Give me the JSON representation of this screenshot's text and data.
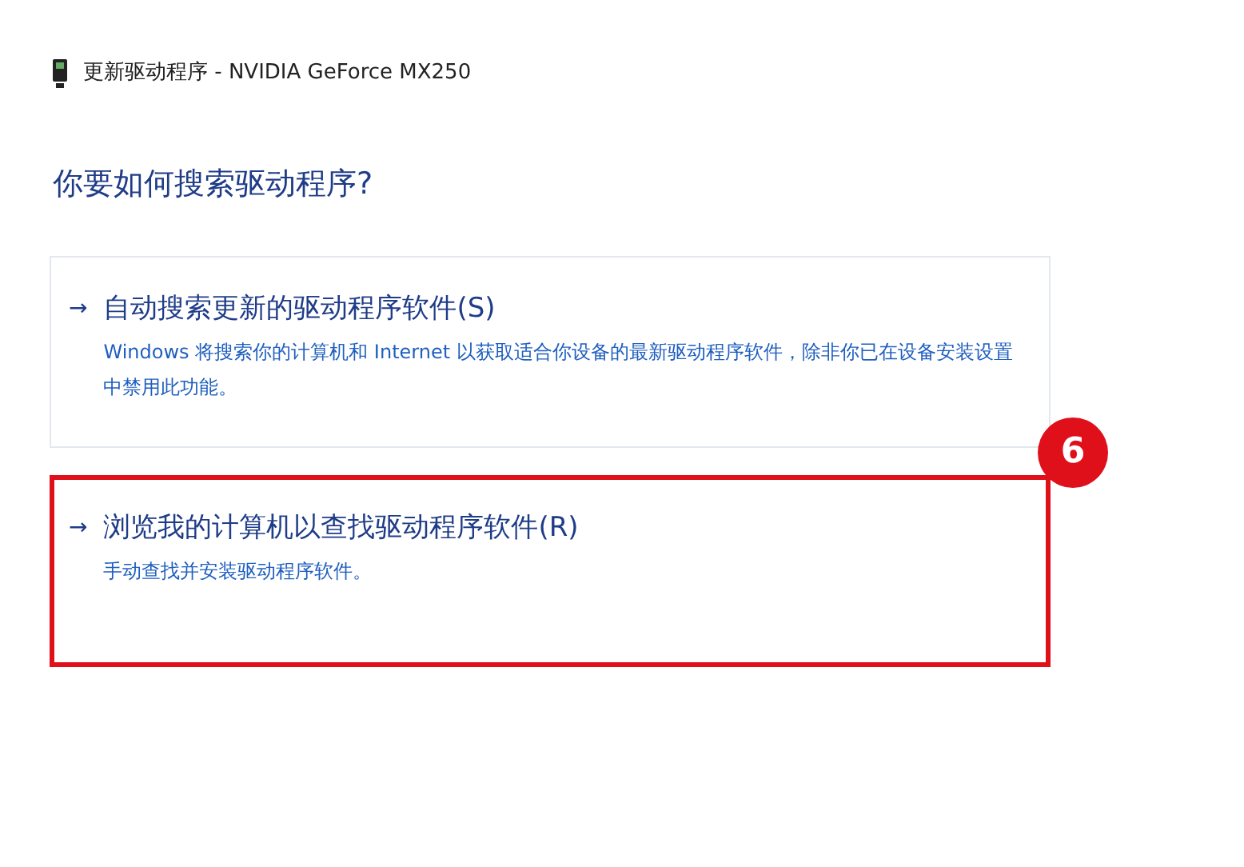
{
  "window": {
    "title": "更新驱动程序 - NVIDIA GeForce MX250"
  },
  "heading": "你要如何搜索驱动程序?",
  "options": [
    {
      "arrow": "→",
      "title": "自动搜索更新的驱动程序软件(S)",
      "description": "Windows 将搜索你的计算机和 Internet 以获取适合你设备的最新驱动程序软件，除非你已在设备安装设置中禁用此功能。",
      "highlighted": false
    },
    {
      "arrow": "→",
      "title": "浏览我的计算机以查找驱动程序软件(R)",
      "description": "手动查找并安装驱动程序软件。",
      "highlighted": true,
      "badge": "6"
    }
  ]
}
